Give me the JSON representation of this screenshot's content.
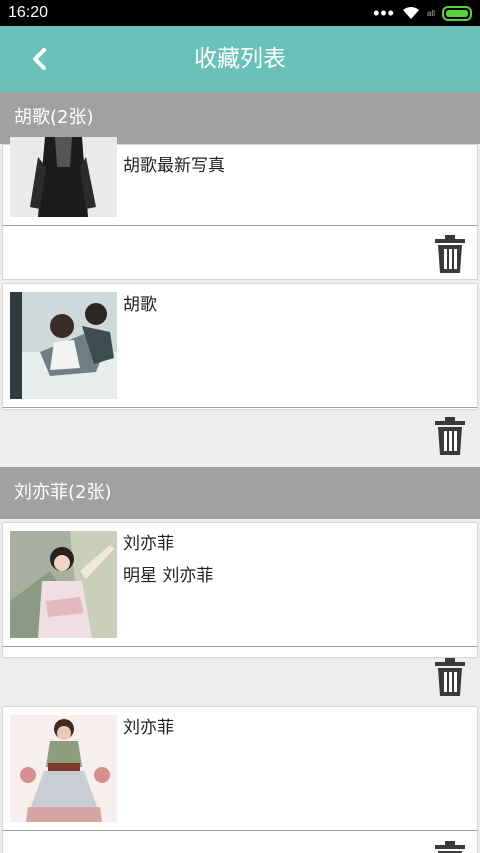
{
  "status_bar": {
    "time": "16:20",
    "dots": "•••",
    "signal_text": "all"
  },
  "header": {
    "title": "收藏列表",
    "back_icon": "chevron-left-icon"
  },
  "colors": {
    "appbar": "#6ac1b7",
    "section": "#a1a1a1",
    "battery": "#58d236"
  },
  "groups": [
    {
      "header": "胡歌(2张)",
      "items": [
        {
          "title": "胡歌最新写真",
          "subtitle": ""
        },
        {
          "title": "胡歌",
          "subtitle": ""
        }
      ]
    },
    {
      "header": "刘亦菲(2张)",
      "items": [
        {
          "title": "刘亦菲",
          "subtitle": "明星 刘亦菲"
        },
        {
          "title": "刘亦菲",
          "subtitle": ""
        }
      ]
    }
  ]
}
